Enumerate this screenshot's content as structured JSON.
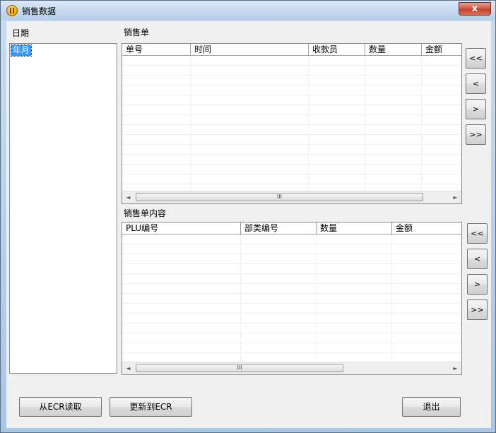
{
  "window": {
    "title": "销售数据",
    "close_glyph": "x",
    "icon": "app-coin-icon"
  },
  "labels": {
    "date": "日期",
    "sales_orders": "销售单",
    "order_details": "销售单内容"
  },
  "date_list": {
    "items": [
      "年月"
    ]
  },
  "orders_table": {
    "columns": [
      "单号",
      "时间",
      "收款员",
      "数量",
      "金额"
    ]
  },
  "details_table": {
    "columns": [
      "PLU编号",
      "部类编号",
      "数量",
      "金额"
    ]
  },
  "nav": {
    "first": "<<",
    "prev": "<",
    "next": ">",
    "last": ">>"
  },
  "scroll": {
    "left": "◄",
    "right": "►",
    "grip": "III"
  },
  "buttons": {
    "read_from_ecr": "从ECR读取",
    "update_to_ecr": "更新到ECR",
    "exit": "退出"
  }
}
